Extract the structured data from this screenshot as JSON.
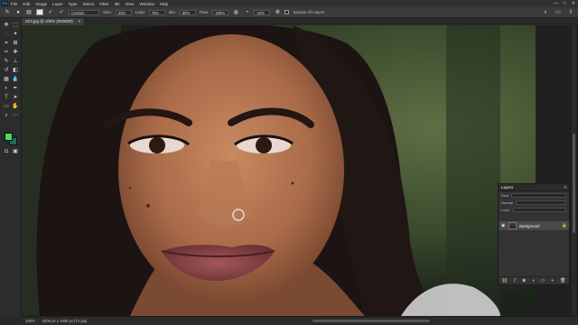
{
  "app": {
    "logo": "Ps"
  },
  "menu": [
    "File",
    "Edit",
    "Image",
    "Layer",
    "Type",
    "Select",
    "Filter",
    "3D",
    "View",
    "Window",
    "Help"
  ],
  "window_controls": [
    "—",
    "□",
    "✕"
  ],
  "options": {
    "brush_mode": "Custom",
    "size_label": "Size:",
    "size_value": "22%",
    "load_label": "Load:",
    "load_value": "75%",
    "mix_label": "Mix:",
    "mix_value": "80%",
    "flow_label": "Flow:",
    "flow_value": "100%",
    "smoothing_value": "10%",
    "sample_all_layers": "Sample All Layers"
  },
  "document": {
    "tab_title": "ZZ3.jpg @ 100% (RGB/8#)",
    "close": "×"
  },
  "colors": {
    "foreground": "#4dd96a",
    "background": "#1d6b63",
    "accent": "#31a8ff"
  },
  "layers_panel": {
    "title": "Layers",
    "menu_icon": "≡",
    "kind_label": "Kind",
    "normal_label": "Normal",
    "lock_label": "Lock:",
    "layer_name": "Background",
    "footer_icons": [
      "link-icon",
      "fx-icon",
      "mask-icon",
      "adjustment-icon",
      "group-icon",
      "new-layer-icon",
      "trash-icon"
    ]
  },
  "status": {
    "zoom": "100%",
    "doc_info": "3200 px x 1800 px (72 ppi)"
  }
}
